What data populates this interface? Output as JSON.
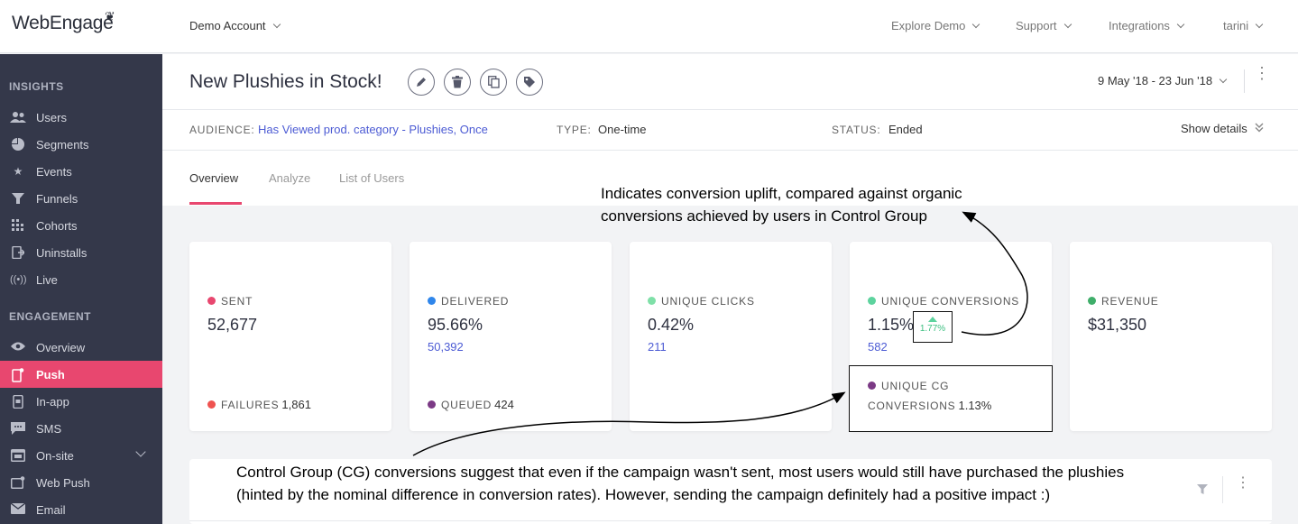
{
  "app": {
    "logo": "WebEngage",
    "account": "Demo Account"
  },
  "topnav": [
    "Explore Demo",
    "Support",
    "Integrations",
    "tarini"
  ],
  "sidebar": {
    "sections": [
      "INSIGHTS",
      "ENGAGEMENT"
    ],
    "insights": [
      {
        "label": "Users",
        "icon": "users-icon"
      },
      {
        "label": "Segments",
        "icon": "pie-icon"
      },
      {
        "label": "Events",
        "icon": "star-icon"
      },
      {
        "label": "Funnels",
        "icon": "funnel-icon"
      },
      {
        "label": "Cohorts",
        "icon": "grid-icon"
      },
      {
        "label": "Uninstalls",
        "icon": "uninstall-icon"
      },
      {
        "label": "Live",
        "icon": "live-icon"
      }
    ],
    "engagement": [
      {
        "label": "Overview",
        "icon": "eye-icon"
      },
      {
        "label": "Push",
        "icon": "push-icon",
        "active": true
      },
      {
        "label": "In-app",
        "icon": "inapp-icon"
      },
      {
        "label": "SMS",
        "icon": "sms-icon"
      },
      {
        "label": "On-site",
        "icon": "onsite-icon"
      },
      {
        "label": "Web Push",
        "icon": "webpush-icon"
      },
      {
        "label": "Email",
        "icon": "email-icon"
      }
    ]
  },
  "campaign": {
    "title": "New Plushies in Stock!",
    "date_range": "9 May '18 - 23 Jun '18",
    "audience_key": "AUDIENCE:",
    "audience_value": "Has Viewed prod. category - Plushies, Once",
    "type_key": "TYPE:",
    "type_value": "One-time",
    "status_key": "STATUS:",
    "status_value": "Ended",
    "show_details": "Show details"
  },
  "tabs": [
    "Overview",
    "Analyze",
    "List of Users"
  ],
  "cards": {
    "sent": {
      "label": "SENT",
      "value": "52,677",
      "foot_label": "FAILURES",
      "foot_value": "1,861"
    },
    "delivered": {
      "label": "DELIVERED",
      "value": "95.66%",
      "sub": "50,392",
      "foot_label": "QUEUED",
      "foot_value": "424"
    },
    "clicks": {
      "label": "UNIQUE CLICKS",
      "value": "0.42%",
      "sub": "211"
    },
    "conversions": {
      "label": "UNIQUE CONVERSIONS",
      "value": "1.15%",
      "sub": "582",
      "uplift": "1.77%",
      "cg_label_1": "UNIQUE CG",
      "cg_label_2": "CONVERSIONS",
      "cg_value": "1.13%"
    },
    "revenue": {
      "label": "REVENUE",
      "value": "$31,350"
    }
  },
  "colors": {
    "accent": "#e8476f",
    "sent": "#e8476f",
    "delivered": "#2f86eb",
    "clicks": "#7fe0a8",
    "conversions": "#5dd39e",
    "revenue": "#3fae6a",
    "failures": "#ef5350",
    "queued": "#7b3a85",
    "cg": "#7b3a85",
    "link": "#4c5bd4"
  },
  "annotations": {
    "top": [
      "Indicates conversion uplift, compared against organic",
      "conversions achieved by users in Control Group"
    ],
    "bottom": [
      "Control Group (CG) conversions suggest that even if the campaign wasn't sent, most users would still have purchased the plushies",
      "(hinted by the nominal difference in conversion rates). However, sending the campaign definitely had a positive impact :)"
    ]
  }
}
